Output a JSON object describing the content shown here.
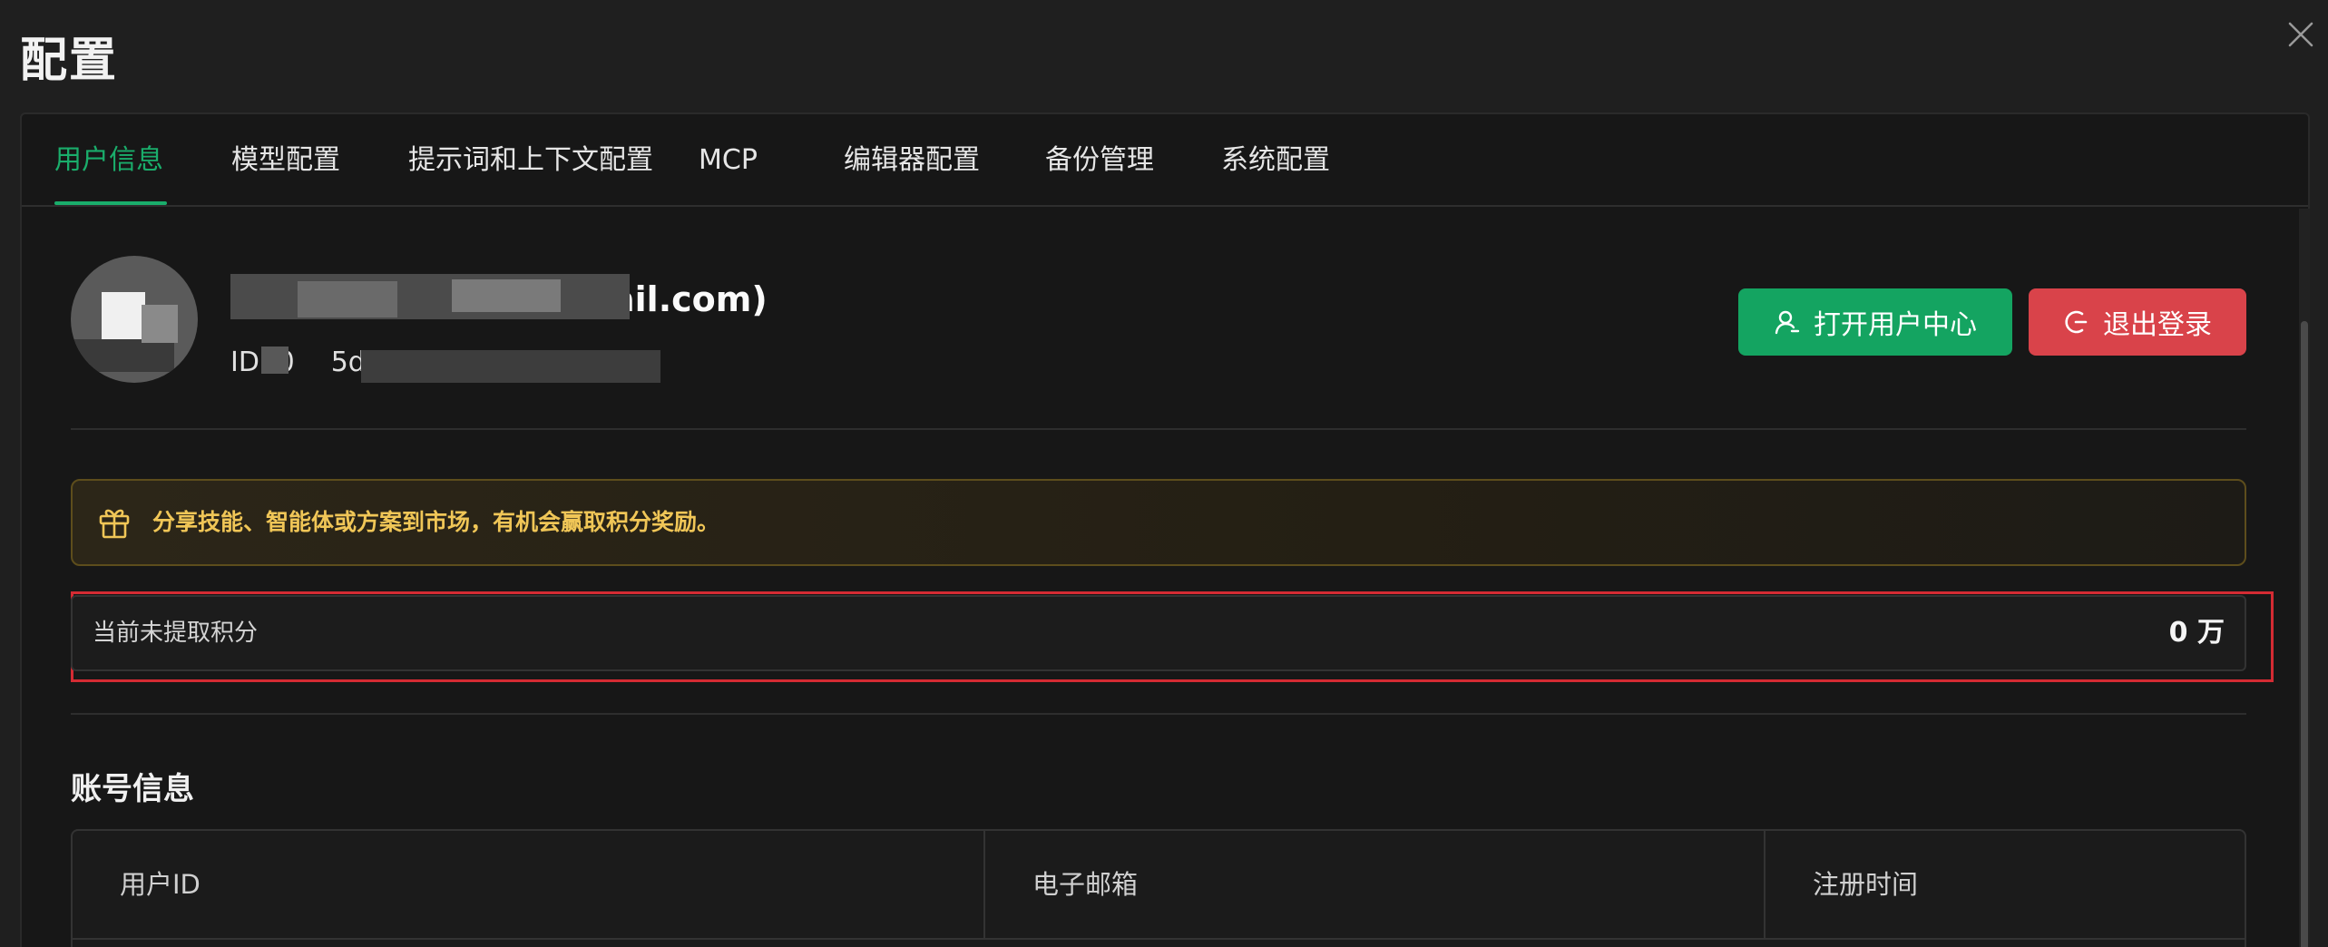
{
  "page": {
    "title": "配置"
  },
  "tabs": [
    {
      "label": "用户信息",
      "active": true
    },
    {
      "label": "模型配置"
    },
    {
      "label": "提示词和上下文配置"
    },
    {
      "label": "MCP"
    },
    {
      "label": "编辑器配置"
    },
    {
      "label": "备份管理"
    },
    {
      "label": "系统配置"
    }
  ],
  "profile": {
    "name_visible": "ail.com)",
    "id_prefix": "ID: 0",
    "id_fragment": "5dddf"
  },
  "actions": {
    "open_user_center": "打开用户中心",
    "logout": "退出登录"
  },
  "notice": {
    "text": "分享技能、智能体或方案到市场，有机会赢取积分奖励。"
  },
  "points": {
    "label": "当前未提取积分",
    "value": "0 万"
  },
  "account": {
    "title": "账号信息",
    "columns": [
      "用户ID",
      "电子邮箱",
      "注册时间"
    ]
  },
  "colors": {
    "accent": "#1aad6b",
    "primary_button": "#14a461",
    "danger_button": "#d9434a",
    "notice_text": "#f0c657",
    "highlight_border": "#d42b33"
  }
}
